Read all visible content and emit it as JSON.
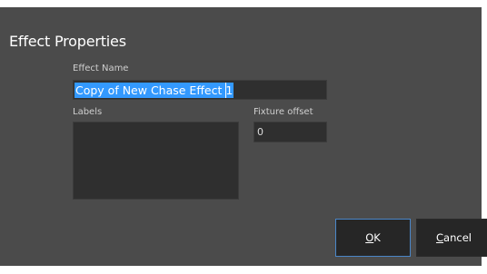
{
  "dialog": {
    "title": "Effect Properties"
  },
  "effect_name": {
    "label": "Effect Name",
    "value": "Copy of New Chase Effect 1"
  },
  "labels": {
    "label": "Labels",
    "value": ""
  },
  "fixture_offset": {
    "label": "Fixture offset",
    "value": "0"
  },
  "buttons": {
    "ok": {
      "mnemonic": "O",
      "rest": "K"
    },
    "cancel": {
      "mnemonic": "C",
      "rest": "ancel"
    }
  },
  "colors": {
    "panel_bg": "#4b4b4b",
    "input_bg": "#2f2f2f",
    "selection": "#3399ff",
    "button_bg": "#262626",
    "focus_border": "#4a86c8"
  }
}
